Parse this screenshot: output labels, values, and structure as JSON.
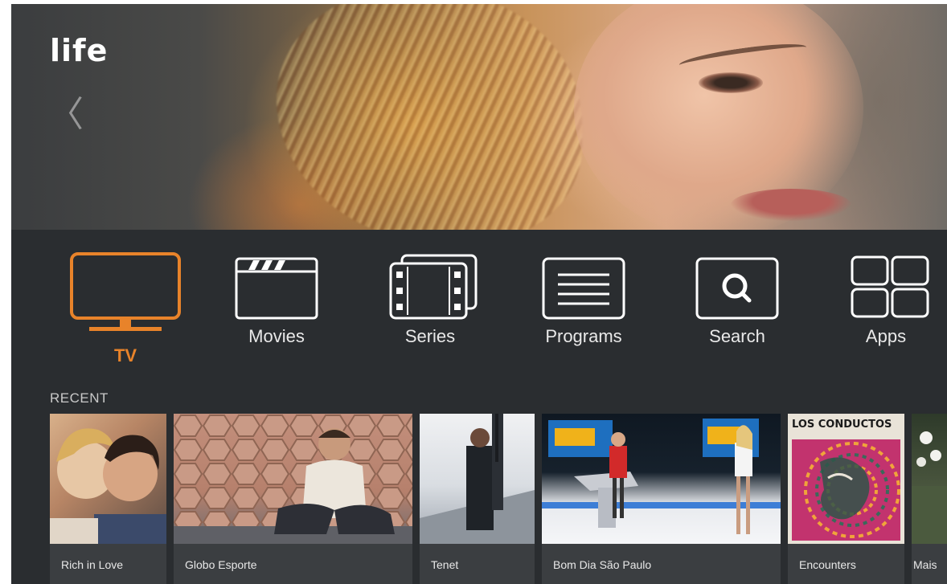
{
  "app": {
    "logo_text": "life"
  },
  "hero": {
    "prev_icon": "chevron-left-icon",
    "prev_glyph": "〈"
  },
  "nav": {
    "accent_color": "#e8832a",
    "items": [
      {
        "label": "TV",
        "icon": "tv-icon",
        "active": true
      },
      {
        "label": "Movies",
        "icon": "clapperboard-icon",
        "active": false
      },
      {
        "label": "Series",
        "icon": "film-strip-icon",
        "active": false
      },
      {
        "label": "Programs",
        "icon": "list-icon",
        "active": false
      },
      {
        "label": "Search",
        "icon": "search-icon",
        "active": false
      },
      {
        "label": "Apps",
        "icon": "apps-grid-icon",
        "active": false
      }
    ]
  },
  "recent": {
    "title": "RECENT",
    "items": [
      {
        "title": "Rich in Love"
      },
      {
        "title": "Globo Esporte"
      },
      {
        "title": "Tenet"
      },
      {
        "title": "Bom Dia São Paulo"
      },
      {
        "title": "Encounters",
        "poster_text": "LOS CONDUCTOS"
      },
      {
        "title": "Mais"
      }
    ]
  }
}
